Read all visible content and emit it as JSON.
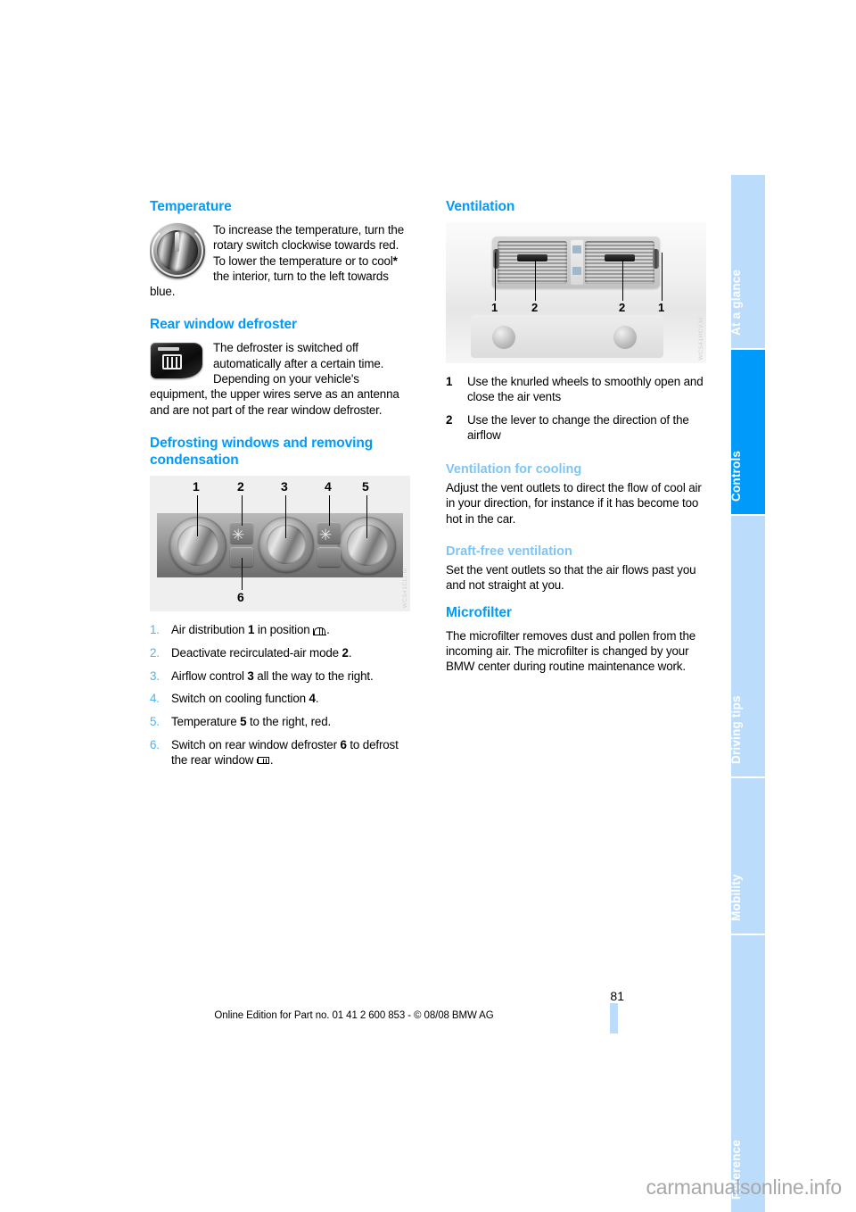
{
  "sidebar": {
    "tabs": [
      {
        "label": "At a glance",
        "active": false
      },
      {
        "label": "Controls",
        "active": true
      },
      {
        "label": "Driving tips",
        "active": false
      },
      {
        "label": "Mobility",
        "active": false
      },
      {
        "label": "Reference",
        "active": false
      }
    ],
    "colors": {
      "active": "#009bfa",
      "inactive": "#bcdcfb",
      "text": "#ffffff"
    }
  },
  "left_column": {
    "temperature": {
      "heading": "Temperature",
      "image_name": "temperature-rotary-knob",
      "paragraph_1": "To increase the temperature, turn the rotary switch clockwise towards red.",
      "paragraph_2_pre": "To lower the temperature or to cool",
      "paragraph_2_star": "*",
      "paragraph_2_post": " the interior, turn to the left towards blue."
    },
    "rear_defroster": {
      "heading": "Rear window defroster",
      "image_name": "rear-window-defroster-button",
      "paragraph": "The defroster is switched off automatically after a certain time. Depending on your vehicle's equipment, the upper wires serve as an antenna and are not part of the rear window defroster."
    },
    "defrosting": {
      "heading": "Defrosting windows and removing condensation",
      "figure": {
        "name": "climate-control-panel-figure",
        "callouts": [
          "1",
          "2",
          "3",
          "4",
          "5",
          "6"
        ],
        "code": "WCS41CLI.tif"
      },
      "steps": [
        {
          "num": "1.",
          "pre": "Air distribution ",
          "bold": "1",
          "mid": " in position ",
          "icon": "windshield-defrost-icon",
          "post": "."
        },
        {
          "num": "2.",
          "pre": "Deactivate recirculated-air mode ",
          "bold": "2",
          "mid": "",
          "icon": "",
          "post": "."
        },
        {
          "num": "3.",
          "pre": "Airflow control ",
          "bold": "3",
          "mid": " all the way to the right.",
          "icon": "",
          "post": ""
        },
        {
          "num": "4.",
          "pre": "Switch on cooling function ",
          "bold": "4",
          "mid": "",
          "icon": "",
          "post": "."
        },
        {
          "num": "5.",
          "pre": "Temperature ",
          "bold": "5",
          "mid": " to the right, red.",
          "icon": "",
          "post": ""
        },
        {
          "num": "6.",
          "pre": "Switch on rear window defroster ",
          "bold": "6",
          "mid": " to defrost the rear window ",
          "icon": "rear-window-defrost-icon",
          "post": "."
        }
      ]
    }
  },
  "right_column": {
    "ventilation": {
      "heading": "Ventilation",
      "figure": {
        "name": "center-air-vents-figure",
        "callouts": [
          "1",
          "2",
          "2",
          "1"
        ],
        "code": "WCS41HCV.tif"
      },
      "items": [
        {
          "num": "1",
          "text": "Use the knurled wheels to smoothly open and close the air vents"
        },
        {
          "num": "2",
          "text": "Use the lever to change the direction of the airflow"
        }
      ]
    },
    "cooling": {
      "heading": "Ventilation for cooling",
      "paragraph": "Adjust the vent outlets to direct the flow of cool air in your direction, for instance if it has become too hot in the car."
    },
    "draft_free": {
      "heading": "Draft-free ventilation",
      "paragraph": "Set the vent outlets so that the air flows past you and not straight at you."
    },
    "microfilter": {
      "heading": "Microfilter",
      "paragraph": "The microfilter removes dust and pollen from the incoming air. The microfilter is changed by your BMW center during routine maintenance work."
    }
  },
  "footer": {
    "page_number": "81",
    "edition": "Online Edition for Part no. 01 41 2 600 853 - © 08/08 BMW AG"
  },
  "watermark": {
    "text": "carmanualsonline.info"
  }
}
